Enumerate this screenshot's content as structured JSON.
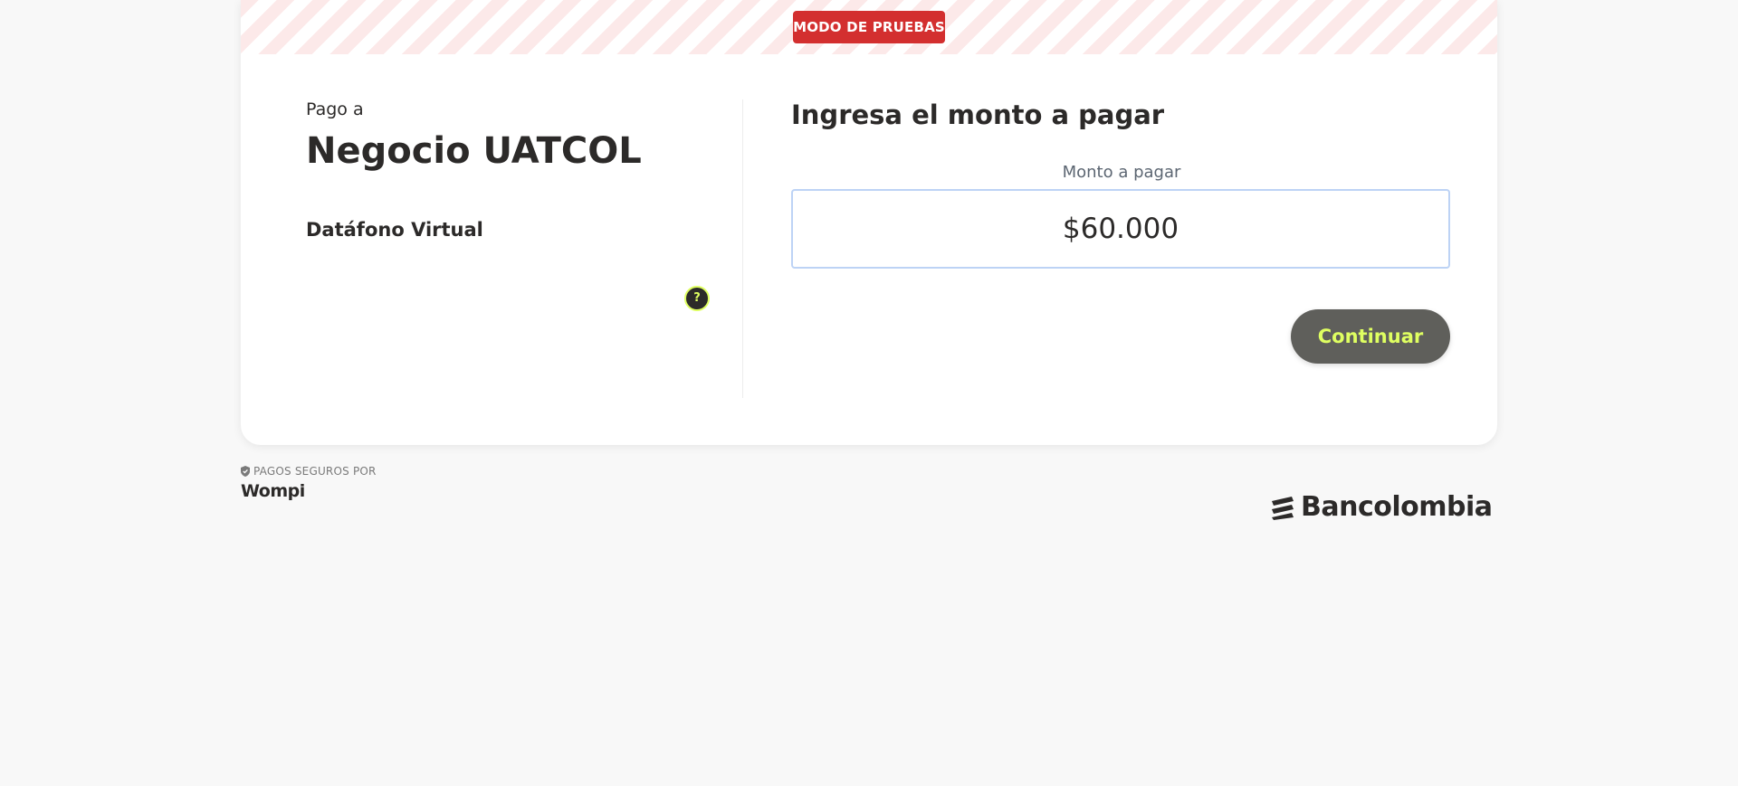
{
  "banner": {
    "test_mode_label": "MODO DE PRUEBAS"
  },
  "merchant": {
    "pay_to_label": "Pago a",
    "name": "Negocio UATCOL",
    "product": "Datáfono Virtual",
    "help_symbol": "?"
  },
  "payment": {
    "title": "Ingresa el monto a pagar",
    "amount_label": "Monto a pagar",
    "amount_value": "$60.000",
    "continue_label": "Continuar"
  },
  "footer": {
    "secure_label": "PAGOS SEGUROS POR",
    "wompi_logo_text": "Wompi",
    "bancolombia_logo_text": "Bancolombia",
    "shield_icon": "shield-check-icon",
    "bancolombia_icon": "bancolombia-stripes-icon"
  },
  "colors": {
    "test_badge": "#d32f2f",
    "accent": "#dfff61",
    "button_bg": "#5f5f5b",
    "input_border": "#bdd3f5",
    "text_primary": "#2c2a29"
  }
}
